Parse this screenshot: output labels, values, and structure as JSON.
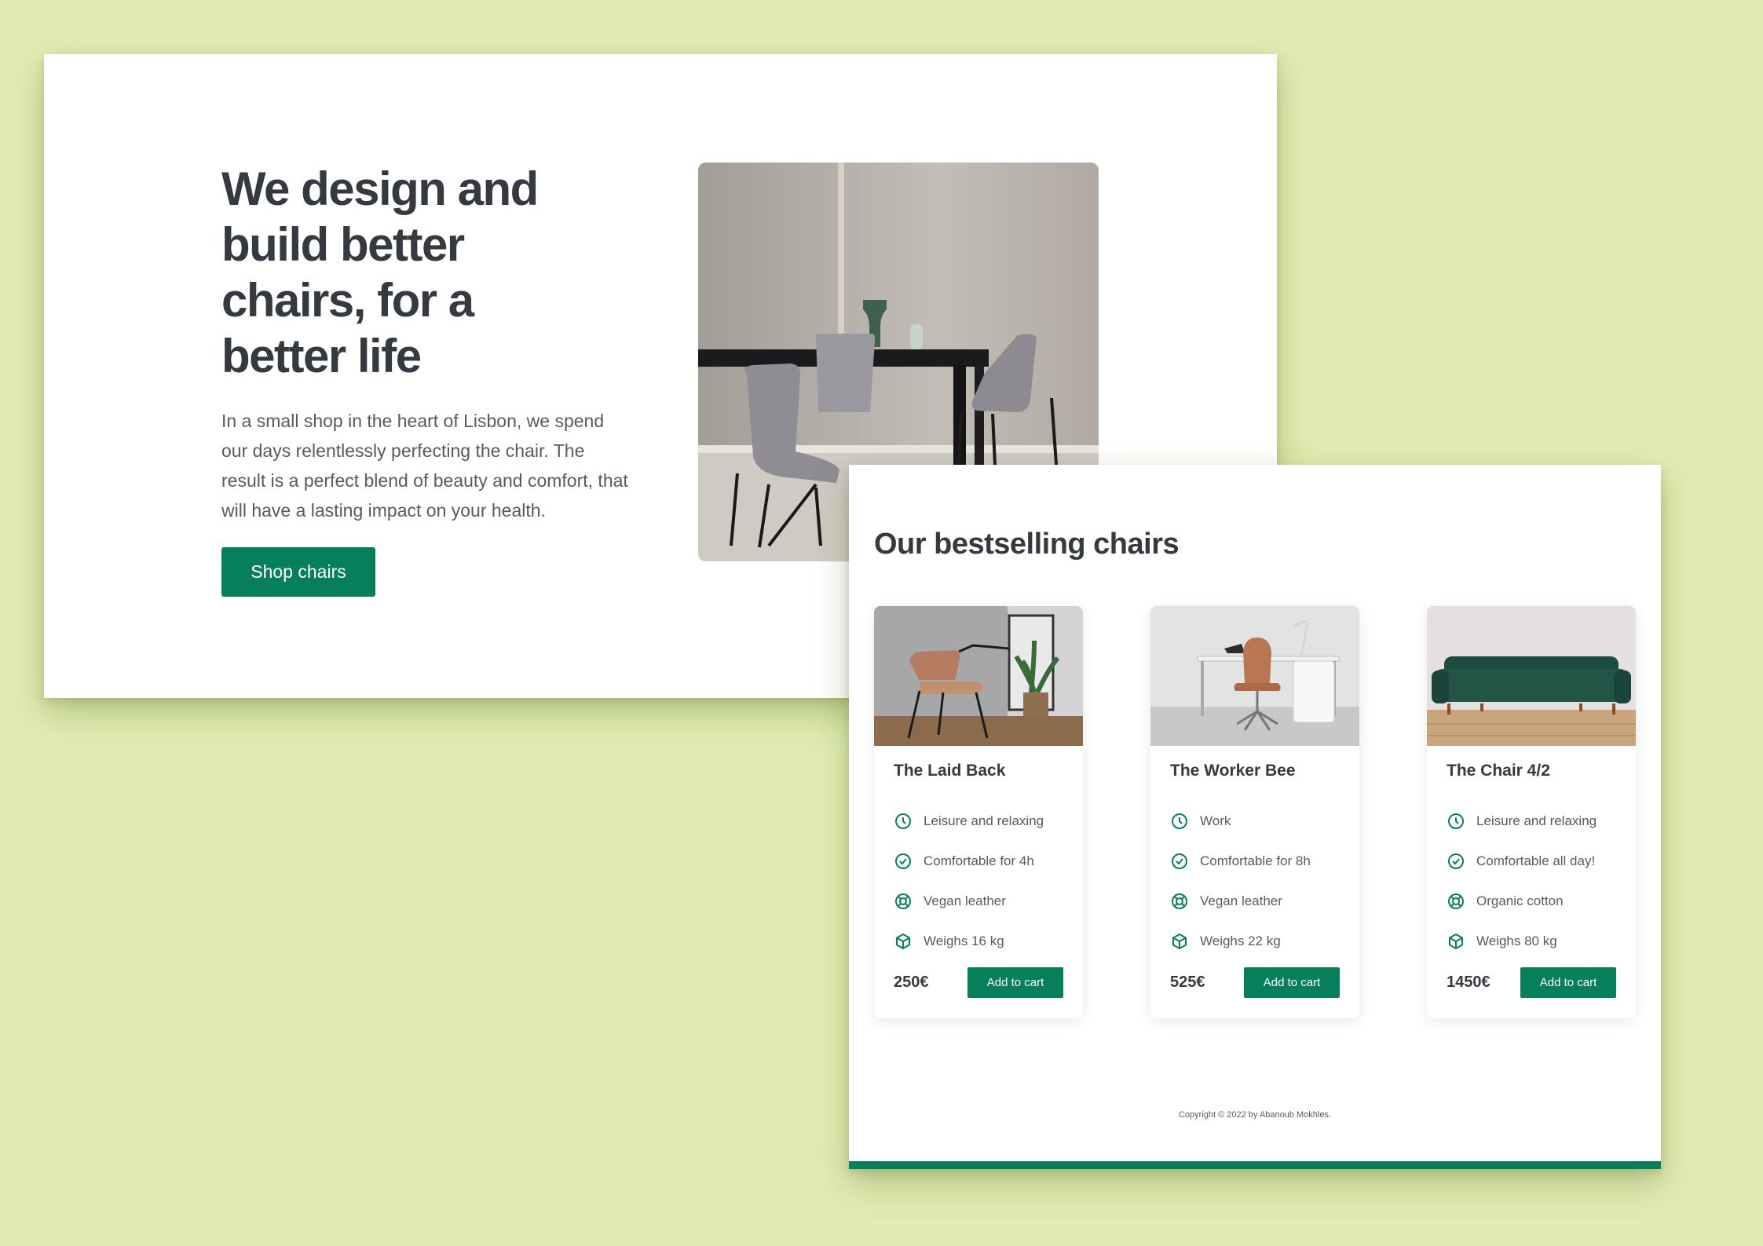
{
  "colors": {
    "background": "#e1ecb2",
    "accent": "#087f5b",
    "text": "#343a40"
  },
  "hero": {
    "title": "We design and build better chairs, for a better life",
    "description": "In a small shop in the heart of Lisbon, we spend our days relentlessly perfecting the chair. The result is a perfect blend of beauty and comfort, that will have a lasting impact on your health.",
    "cta_label": "Shop chairs",
    "image_alt": "dining-room-chairs-photo"
  },
  "products": {
    "title": "Our bestselling chairs",
    "cart_label": "Add to cart",
    "items": [
      {
        "name": "The Laid Back",
        "attributes": [
          {
            "icon": "clock-icon",
            "text": "Leisure and relaxing"
          },
          {
            "icon": "check-circle-icon",
            "text": "Comfortable for 4h"
          },
          {
            "icon": "lifebuoy-icon",
            "text": "Vegan leather"
          },
          {
            "icon": "cube-icon",
            "text": "Weighs 16 kg"
          }
        ],
        "price": "250€",
        "cart_label": "Add to cart"
      },
      {
        "name": "The Worker Bee",
        "attributes": [
          {
            "icon": "clock-icon",
            "text": "Work"
          },
          {
            "icon": "check-circle-icon",
            "text": "Comfortable for 8h"
          },
          {
            "icon": "lifebuoy-icon",
            "text": "Vegan leather"
          },
          {
            "icon": "cube-icon",
            "text": "Weighs 22 kg"
          }
        ],
        "price": "525€",
        "cart_label": "Add to cart"
      },
      {
        "name": "The Chair 4/2",
        "attributes": [
          {
            "icon": "clock-icon",
            "text": "Leisure and relaxing"
          },
          {
            "icon": "check-circle-icon",
            "text": "Comfortable all day!"
          },
          {
            "icon": "lifebuoy-icon",
            "text": "Organic cotton"
          },
          {
            "icon": "cube-icon",
            "text": "Weighs 80 kg"
          }
        ],
        "price": "1450€",
        "cart_label": "Add to cart"
      }
    ]
  },
  "footer": {
    "copyright": "Copyright © 2022 by Abanoub Mokhles."
  }
}
